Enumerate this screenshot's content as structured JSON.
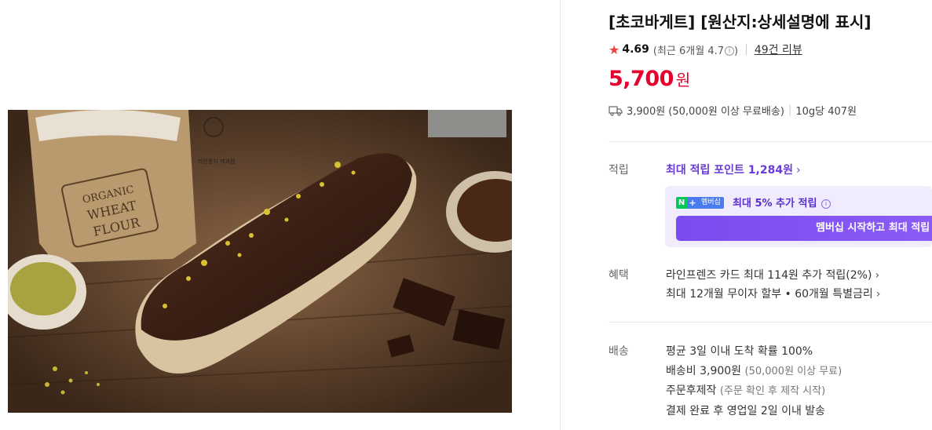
{
  "product": {
    "title": "[초코바게트] [원산지:상세설명에 표시]",
    "rating": "4.69",
    "recent_rating": "(최근 6개월 4.7",
    "recent_rating_close": ")",
    "review_link": "49건 리뷰",
    "price": "5,700",
    "currency": "원",
    "shipping_fee": "3,900원 (50,000원 이상 무료배송)",
    "unit_price": "10g당 407원",
    "image_text": {
      "bag_line1": "ORGANIC",
      "bag_line2": "WHEAT",
      "bag_line3": "FLOUR",
      "logo": "라인풍차 제과점"
    }
  },
  "points": {
    "label": "적립",
    "link": "최대 적립 포인트 1,284원",
    "badge_n": "N",
    "badge_plus": "+",
    "badge_membership": "멤버십",
    "member_text": "최대 5% 추가 적립",
    "member_button": "멤버십 시작하고 최대 적립"
  },
  "benefits": {
    "label": "혜택",
    "items": [
      "라인프렌즈 카드 최대 114원 추가 적립(2%)",
      "최대 12개월 무이자 할부 • 60개월 특별금리"
    ]
  },
  "delivery": {
    "label": "배송",
    "line1": "평균 3일 이내 도착 확률 100%",
    "line2_main": "배송비 3,900원",
    "line2_sub": "(50,000원 이상 무료)",
    "line3_main": "주문후제작",
    "line3_sub": "(주문 확인 후 제작 시작)",
    "line4": "결제 완료 후 영업일 2일 이내 발송"
  },
  "colors": {
    "price": "#e4032e",
    "accent_purple": "#6a3bd8",
    "star": "#f04040",
    "naver_green": "#03c75a"
  }
}
